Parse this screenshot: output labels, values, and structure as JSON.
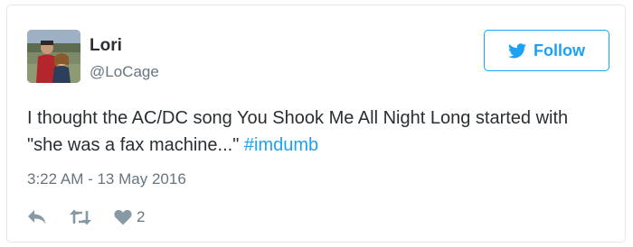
{
  "user": {
    "name": "Lori",
    "handle": "@LoCage",
    "avatar_icon": "profile-photo"
  },
  "follow_button": {
    "label": "Follow",
    "icon": "twitter-bird-icon"
  },
  "tweet": {
    "text": "I thought the AC/DC song You Shook Me All Night Long started with \"she was a fax machine...\" ",
    "hashtag": "#imdumb",
    "timestamp": "3:22 AM - 13 May 2016"
  },
  "actions": {
    "reply_icon": "reply-icon",
    "retweet_icon": "retweet-icon",
    "like_icon": "heart-icon",
    "like_count": "2"
  },
  "colors": {
    "accent": "#1da1f2",
    "text": "#292f33",
    "muted": "#66757f",
    "icon": "#8899a6",
    "border": "#e1e8ed"
  }
}
